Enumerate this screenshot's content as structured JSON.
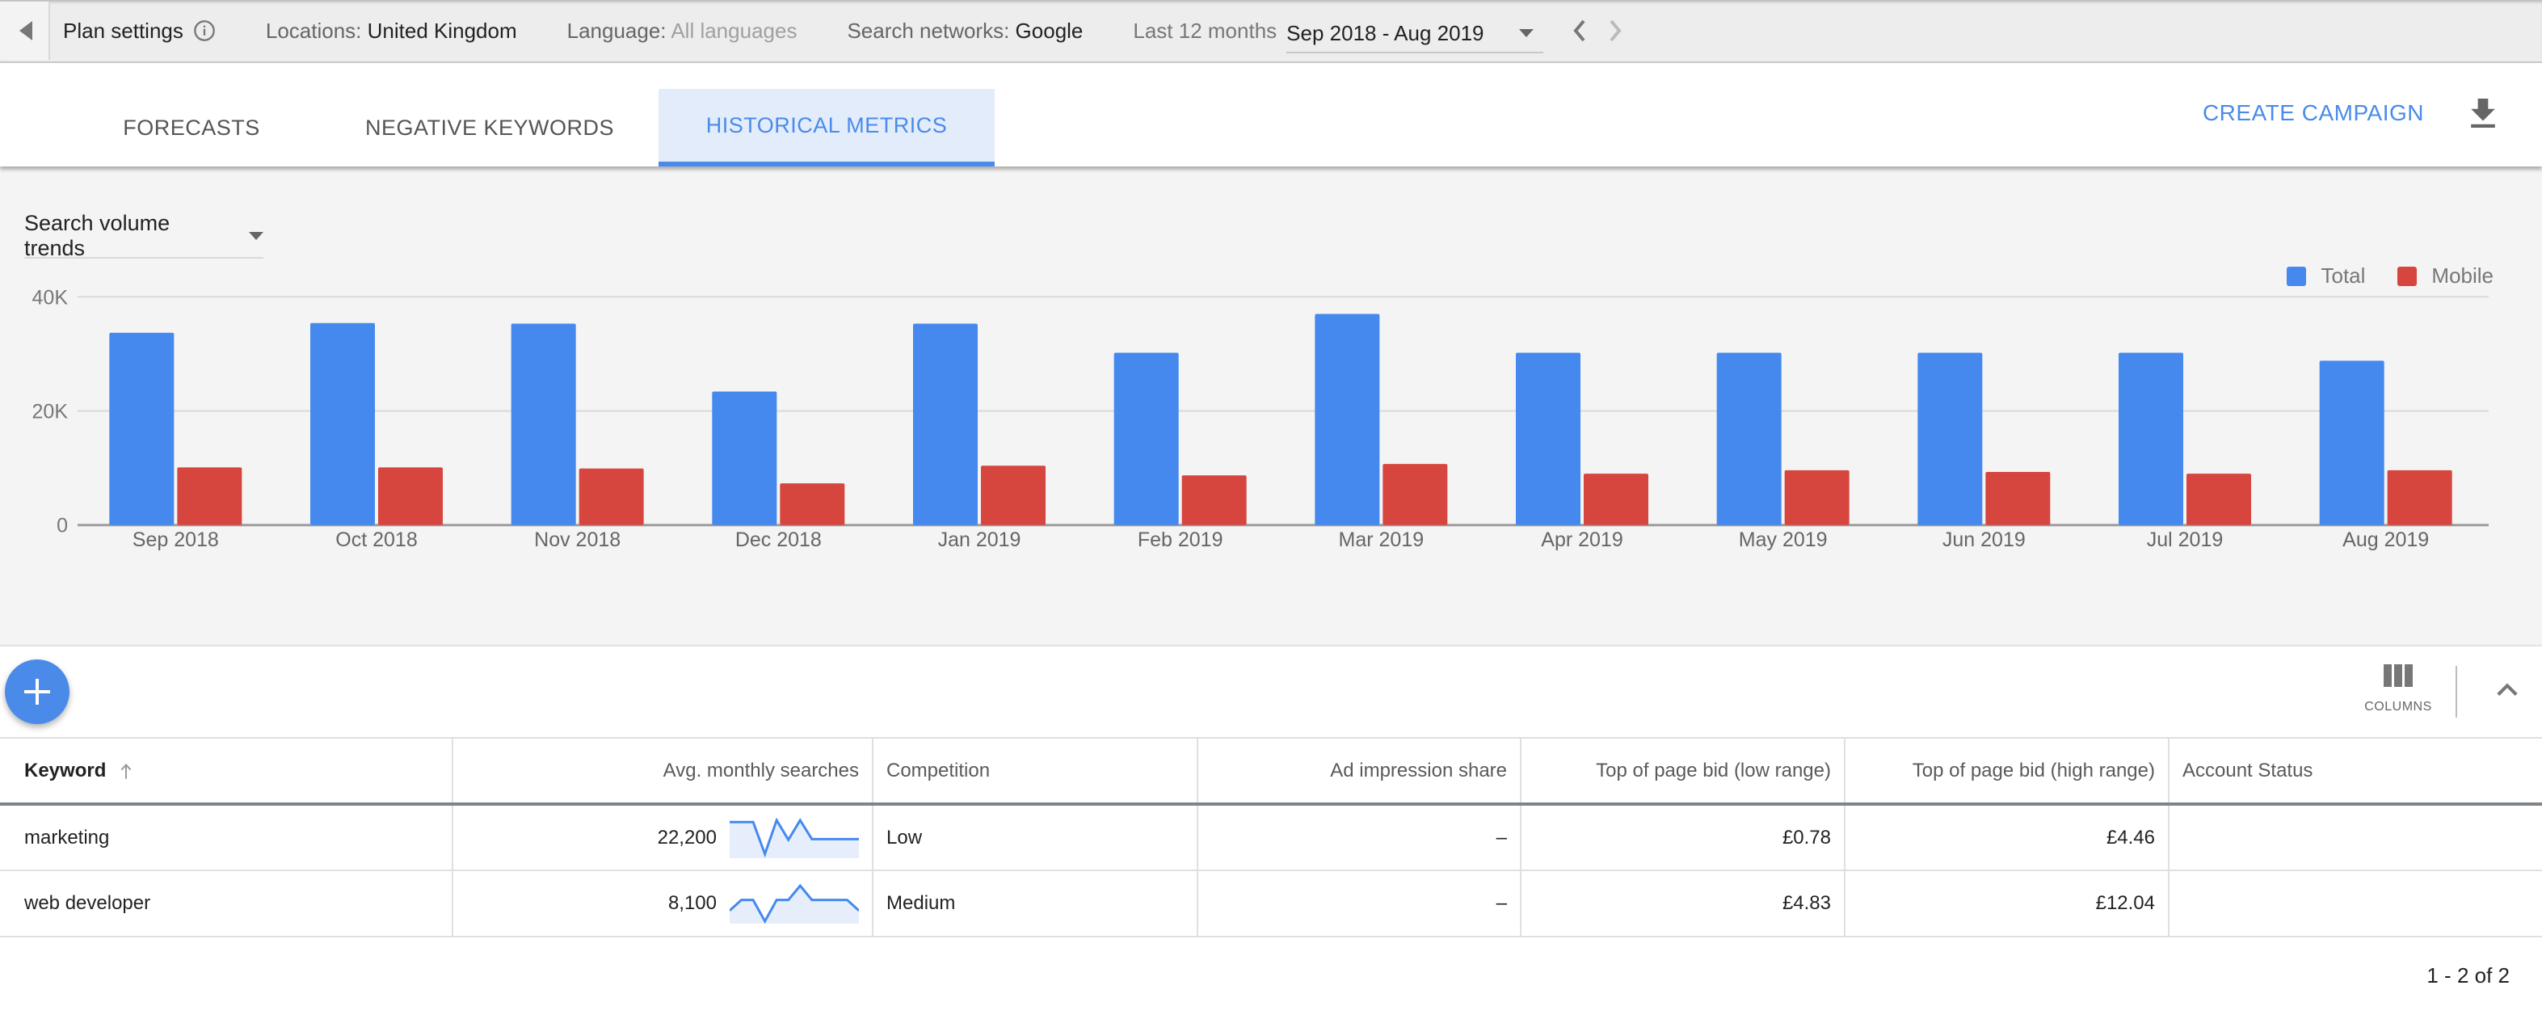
{
  "topbar": {
    "plan_settings": "Plan settings",
    "locations_label": "Locations: ",
    "locations_value": "United Kingdom",
    "language_label": "Language: ",
    "language_value": "All languages",
    "networks_label": "Search networks: ",
    "networks_value": "Google",
    "date_label": "Last 12 months",
    "date_value": "Sep 2018 - Aug 2019"
  },
  "tabs": [
    {
      "label": "FORECASTS",
      "active": false
    },
    {
      "label": "NEGATIVE KEYWORDS",
      "active": false
    },
    {
      "label": "HISTORICAL METRICS",
      "active": true
    }
  ],
  "actions": {
    "create_campaign": "CREATE CAMPAIGN"
  },
  "chart_selector": "Search volume trends",
  "colors": {
    "total": "#4589ee",
    "mobile": "#d6463e",
    "accent": "#4a8be9"
  },
  "chart_data": {
    "type": "bar",
    "title": "Search volume trends",
    "categories": [
      "Sep 2018",
      "Oct 2018",
      "Nov 2018",
      "Dec 2018",
      "Jan 2019",
      "Feb 2019",
      "Mar 2019",
      "Apr 2019",
      "May 2019",
      "Jun 2019",
      "Jul 2019",
      "Aug 2019"
    ],
    "series": [
      {
        "name": "Total",
        "values": [
          33700,
          35400,
          35300,
          23400,
          35300,
          30200,
          37000,
          30200,
          30200,
          30200,
          30200,
          28800
        ]
      },
      {
        "name": "Mobile",
        "values": [
          10100,
          10100,
          9900,
          7300,
          10400,
          8700,
          10700,
          9000,
          9600,
          9300,
          9000,
          9600
        ]
      }
    ],
    "yticks": [
      {
        "value": 0,
        "label": "0"
      },
      {
        "value": 20000,
        "label": "20K"
      },
      {
        "value": 40000,
        "label": "40K"
      }
    ],
    "ylim": [
      0,
      40000
    ],
    "xlabel": "",
    "ylabel": "",
    "grid": true,
    "legend": "top-right"
  },
  "toolbar": {
    "columns_label": "COLUMNS"
  },
  "table": {
    "headers": [
      "Keyword",
      "Avg. monthly searches",
      "Competition",
      "Ad impression share",
      "Top of page bid (low range)",
      "Top of page bid (high range)",
      "Account Status"
    ],
    "rows": [
      {
        "keyword": "marketing",
        "searches": "22,200",
        "trend": [
          0.95,
          0.95,
          0.95,
          0.05,
          1.0,
          0.45,
          1.0,
          0.47,
          0.47,
          0.47,
          0.47,
          0.47
        ],
        "competition": "Low",
        "impression_share": "–",
        "bid_low": "£0.78",
        "bid_high": "£4.46",
        "status": ""
      },
      {
        "keyword": "web developer",
        "searches": "8,100",
        "trend": [
          0.3,
          0.6,
          0.6,
          0.0,
          0.6,
          0.6,
          1.0,
          0.6,
          0.6,
          0.6,
          0.6,
          0.3
        ],
        "competition": "Medium",
        "impression_share": "–",
        "bid_low": "£4.83",
        "bid_high": "£12.04",
        "status": ""
      }
    ]
  },
  "pagination": "1 - 2 of 2"
}
